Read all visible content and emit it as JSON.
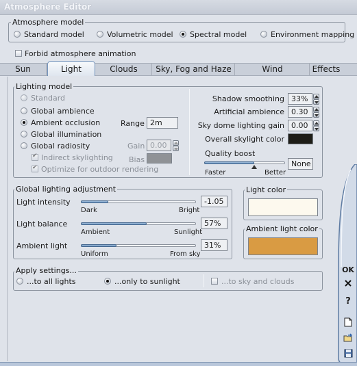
{
  "window": {
    "title": "Atmosphere Editor"
  },
  "atmosphere_model": {
    "legend": "Atmosphere model",
    "options": [
      {
        "label": "Standard model",
        "checked": false
      },
      {
        "label": "Volumetric model",
        "checked": false
      },
      {
        "label": "Spectral model",
        "checked": true
      },
      {
        "label": "Environment mapping",
        "checked": false
      }
    ],
    "forbid_animation_label": "Forbid atmosphere animation",
    "forbid_animation_checked": false
  },
  "tabs": [
    {
      "label": "Sun",
      "active": false
    },
    {
      "label": "Light",
      "active": true
    },
    {
      "label": "Clouds",
      "active": false
    },
    {
      "label": "Sky, Fog and Haze",
      "active": false
    },
    {
      "label": "Wind",
      "active": false
    },
    {
      "label": "Effects",
      "active": false
    }
  ],
  "lighting_model": {
    "legend": "Lighting model",
    "options": [
      {
        "label": "Standard",
        "checked": false,
        "enabled": false
      },
      {
        "label": "Global ambience",
        "checked": false,
        "enabled": true
      },
      {
        "label": "Ambient occlusion",
        "checked": true,
        "enabled": true
      },
      {
        "label": "Global illumination",
        "checked": false,
        "enabled": true
      },
      {
        "label": "Global radiosity",
        "checked": false,
        "enabled": true
      }
    ],
    "range_label": "Range",
    "range_value": "2m",
    "gain_label": "Gain",
    "gain_value": "0.00",
    "bias_label": "Bias",
    "indirect_skylighting_label": "Indirect skylighting",
    "optimize_outdoor_label": "Optimize for outdoor rendering"
  },
  "right_settings": {
    "shadow_smoothing_label": "Shadow smoothing",
    "shadow_smoothing_value": "33%",
    "artificial_ambience_label": "Artificial ambience",
    "artificial_ambience_value": "0.30",
    "sky_dome_gain_label": "Sky dome lighting gain",
    "sky_dome_gain_value": "0.00",
    "overall_skylight_color_label": "Overall skylight color",
    "overall_skylight_color": "#1e1d17",
    "quality_boost_label": "Quality boost",
    "quality_boost_value": "None",
    "quality_boost_level": 0.62,
    "faster_label": "Faster",
    "better_label": "Better"
  },
  "global_lighting": {
    "legend": "Global lighting adjustment",
    "sliders": [
      {
        "label": "Light intensity",
        "value": "-1.05",
        "left": "Dark",
        "right": "Bright",
        "level": 0.24
      },
      {
        "label": "Light balance",
        "value": "57%",
        "left": "Ambient",
        "right": "Sunlight",
        "level": 0.57
      },
      {
        "label": "Ambient light",
        "value": "31%",
        "left": "Uniform",
        "right": "From sky",
        "level": 0.31
      }
    ]
  },
  "light_color": {
    "legend": "Light color",
    "color": "#fdf9ee"
  },
  "ambient_light_color": {
    "legend": "Ambient light color",
    "color": "#d99b43"
  },
  "apply_settings": {
    "legend": "Apply settings...",
    "options": [
      {
        "label": "...to all lights",
        "checked": false
      },
      {
        "label": "...only to sunlight",
        "checked": true
      }
    ],
    "sky_clouds_label": "...to sky and clouds",
    "sky_clouds_checked": false
  },
  "side_panel": {
    "ok_label": "OK",
    "close_icon": "close-icon",
    "help_icon": "help-icon",
    "new_icon": "new-document-icon",
    "load_icon": "load-icon",
    "save_icon": "save-icon"
  }
}
